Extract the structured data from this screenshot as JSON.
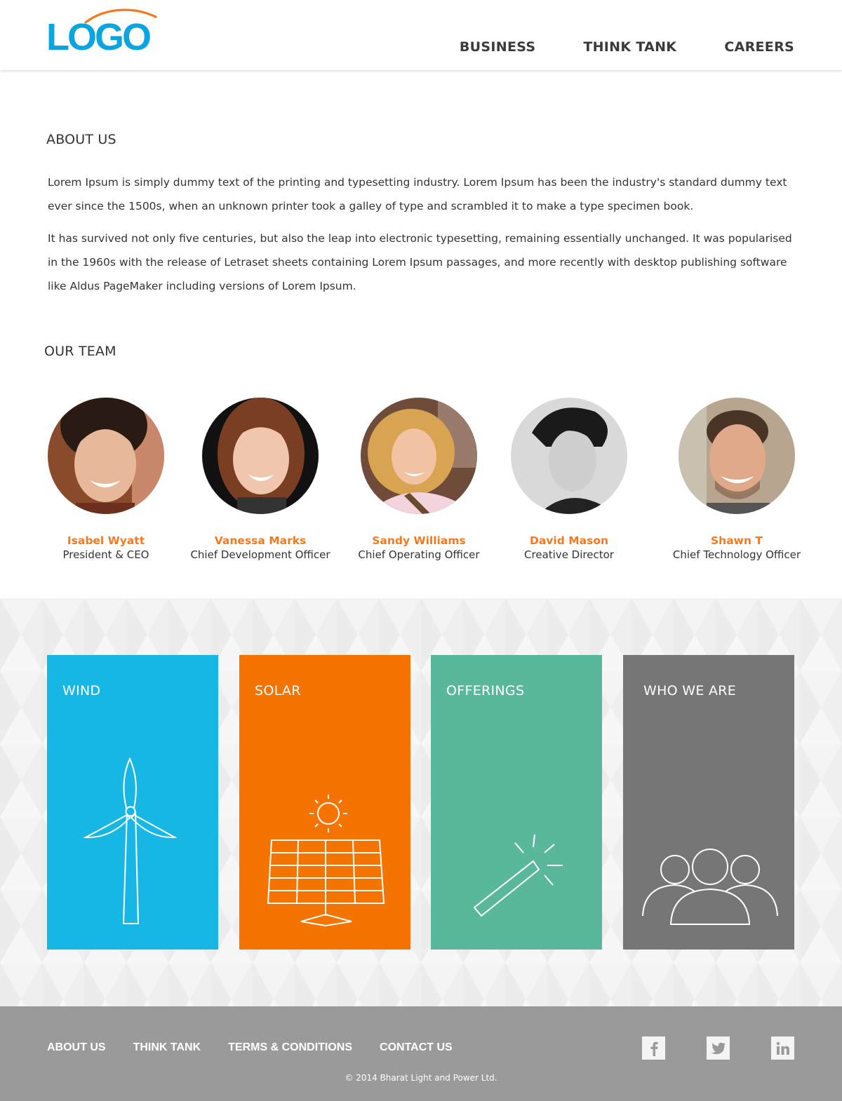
{
  "header": {
    "logo_text": "LOGO",
    "nav": [
      {
        "label": "BUSINESS"
      },
      {
        "label": "THINK TANK"
      },
      {
        "label": "CAREERS"
      }
    ]
  },
  "about": {
    "title": "ABOUT US",
    "paragraphs": [
      "Lorem Ipsum is simply dummy text of the printing and typesetting industry. Lorem Ipsum has been the industry's standard dummy text ever since the 1500s, when an unknown printer took a galley of type and scrambled it to make a type specimen book.",
      "It has survived not only five centuries, but also the leap into electronic typesetting, remaining essentially unchanged. It was popularised in the 1960s with the release of Letraset sheets containing Lorem Ipsum passages, and more recently with desktop publishing software like Aldus PageMaker including versions of Lorem Ipsum."
    ]
  },
  "team": {
    "title": "OUR TEAM",
    "members": [
      {
        "name": "Isabel Wyatt",
        "role": "President & CEO"
      },
      {
        "name": "Vanessa Marks",
        "role": "Chief Development Officer"
      },
      {
        "name": "Sandy Williams",
        "role": "Chief Operating Officer"
      },
      {
        "name": "David Mason",
        "role": "Creative Director"
      },
      {
        "name": "Shawn T",
        "role": "Chief Technology Officer"
      }
    ]
  },
  "tiles": [
    {
      "label": "WIND",
      "icon": "wind-turbine-icon",
      "color": "#17b7e5"
    },
    {
      "label": "SOLAR",
      "icon": "solar-panel-icon",
      "color": "#f57400"
    },
    {
      "label": "OFFERINGS",
      "icon": "magic-wand-icon",
      "color": "#59b79b"
    },
    {
      "label": "WHO WE ARE",
      "icon": "people-group-icon",
      "color": "#767676"
    }
  ],
  "footer": {
    "links": [
      {
        "label": "ABOUT US"
      },
      {
        "label": "THINK TANK"
      },
      {
        "label": "TERMS & CONDITIONS"
      },
      {
        "label": "CONTACT US"
      }
    ],
    "social": [
      "facebook-icon",
      "twitter-icon",
      "linkedin-icon"
    ],
    "copyright": "© 2014 Bharat Light and Power Ltd."
  },
  "colors": {
    "brand_blue": "#0aa5df",
    "accent_orange": "#f57a1f",
    "footer_gray": "#9a9a9a"
  }
}
